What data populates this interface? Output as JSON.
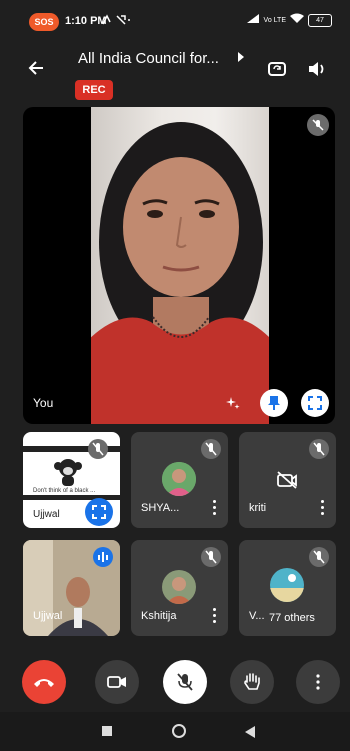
{
  "status_bar": {
    "sos": "SOS",
    "time": "1:10 PM",
    "signal_text": "Vo LTE",
    "battery": "47"
  },
  "header": {
    "title": "All India Council for...",
    "rec_badge": "REC"
  },
  "main_tile": {
    "name": "You"
  },
  "participants": [
    {
      "name": "Ujjwal",
      "muted": true
    },
    {
      "name": "SHYA...",
      "muted": true
    },
    {
      "name": "kriti",
      "muted": true
    },
    {
      "name": "Ujjwal",
      "muted": false
    },
    {
      "name": "Kshitija",
      "muted": true
    },
    {
      "name": "V...",
      "muted": true
    }
  ],
  "screen_share_caption": "Don't think of a black ...",
  "others_label": "77 others",
  "colors": {
    "background": "#1f1f1f",
    "tile": "#3c3c3c",
    "rec": "#d93025",
    "end_call": "#ea4335",
    "sos": "#ef5a2a",
    "speaking": "#1a73e8"
  },
  "icons": [
    "back-arrow-icon",
    "chevron-right-icon",
    "switch-camera-icon",
    "speaker-icon",
    "mic-off-icon",
    "effects-icon",
    "pin-icon",
    "fullscreen-icon",
    "camera-off-icon",
    "end-call-icon",
    "camera-icon",
    "hand-raise-icon",
    "more-icon"
  ]
}
